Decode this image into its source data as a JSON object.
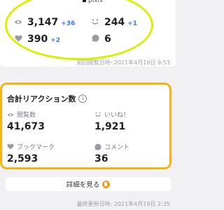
{
  "top_stats": {
    "header_partial": "pixiv",
    "views": {
      "value": "3,147",
      "delta": "+36"
    },
    "likes": {
      "value": "244",
      "delta": "+1"
    },
    "bookmarks": {
      "value": "390",
      "delta": "+2"
    },
    "comments": {
      "value": "6"
    },
    "previous_view_time": "前回閲覧日時: 2021年4月19日 9:53"
  },
  "total_reactions": {
    "title": "合計リアクション数",
    "info_icon": "info-icon",
    "views": {
      "label": "閲覧数",
      "value": "41,673"
    },
    "likes": {
      "label": "いいね！",
      "value": "1,921"
    },
    "bookmarks": {
      "label": "ブックマーク",
      "value": "2,593"
    },
    "comments": {
      "label": "コメント",
      "value": "36"
    }
  },
  "details_button": {
    "label": "詳細を見る"
  },
  "last_updated": "最終更新日時: 2021年4月19日 2:35",
  "colors": {
    "delta_blue": "#3d7bd9",
    "highlight_yellow_green": "#d8f000",
    "highlight_orange": "#f6b315",
    "muted_text": "#a0a0a8"
  }
}
